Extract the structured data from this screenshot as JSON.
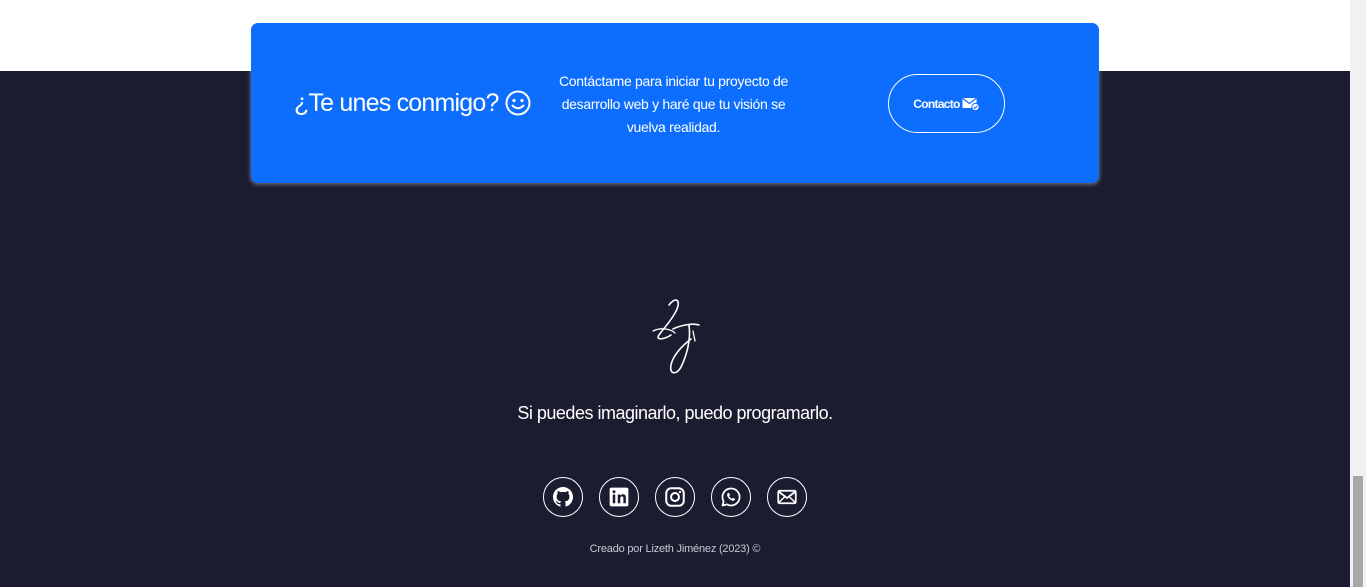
{
  "cta": {
    "title": "¿Te unes conmigo?",
    "title_icon": "smile-icon",
    "text": "Contáctame para iniciar tu proyecto de desarrollo web y haré que tu visión se vuelva realidad.",
    "button_label": "Contacto",
    "button_icon": "envelope-check-icon"
  },
  "footer": {
    "logo": "LJ",
    "tagline": "Si puedes imaginarlo, puedo programarlo.",
    "socials": [
      {
        "name": "github",
        "icon": "github-icon"
      },
      {
        "name": "linkedin",
        "icon": "linkedin-icon"
      },
      {
        "name": "instagram",
        "icon": "instagram-icon"
      },
      {
        "name": "whatsapp",
        "icon": "whatsapp-icon"
      },
      {
        "name": "email",
        "icon": "envelope-icon"
      }
    ],
    "credit": "Creado por Lizeth Jiménez (2023) ©"
  },
  "colors": {
    "accent": "#0d6efd",
    "footer_bg": "#1c1c31",
    "text": "#ffffff"
  }
}
